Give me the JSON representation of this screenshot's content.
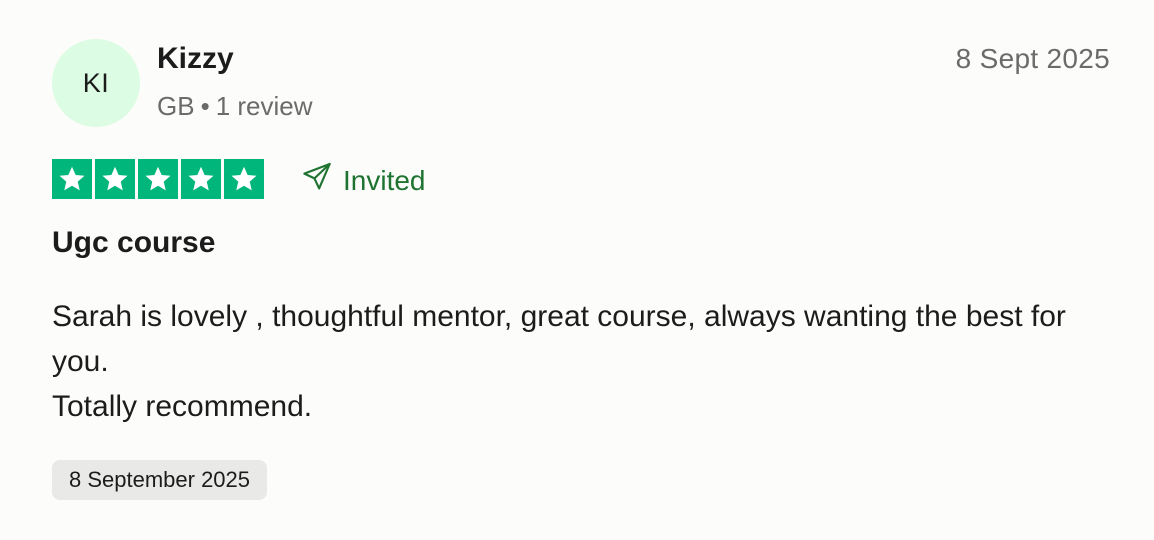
{
  "reviewer": {
    "initials": "KI",
    "name": "Kizzy",
    "country": "GB",
    "separator": "•",
    "review_count": "1 review",
    "avatar_color": "#dcfce3"
  },
  "review": {
    "date_short": "8 Sept 2025",
    "rating": 5,
    "rating_max": 5,
    "star_color": "#00b67a",
    "star_icon": "star-icon",
    "invited_icon": "paper-plane-icon",
    "invited_label": "Invited",
    "invited_color": "#1e7331",
    "title": "Ugc course",
    "body_lines": [
      "Sarah is lovely , thoughtful mentor, great course, always wanting the best for you.",
      "Totally recommend."
    ],
    "experience_date": "8 September 2025"
  }
}
